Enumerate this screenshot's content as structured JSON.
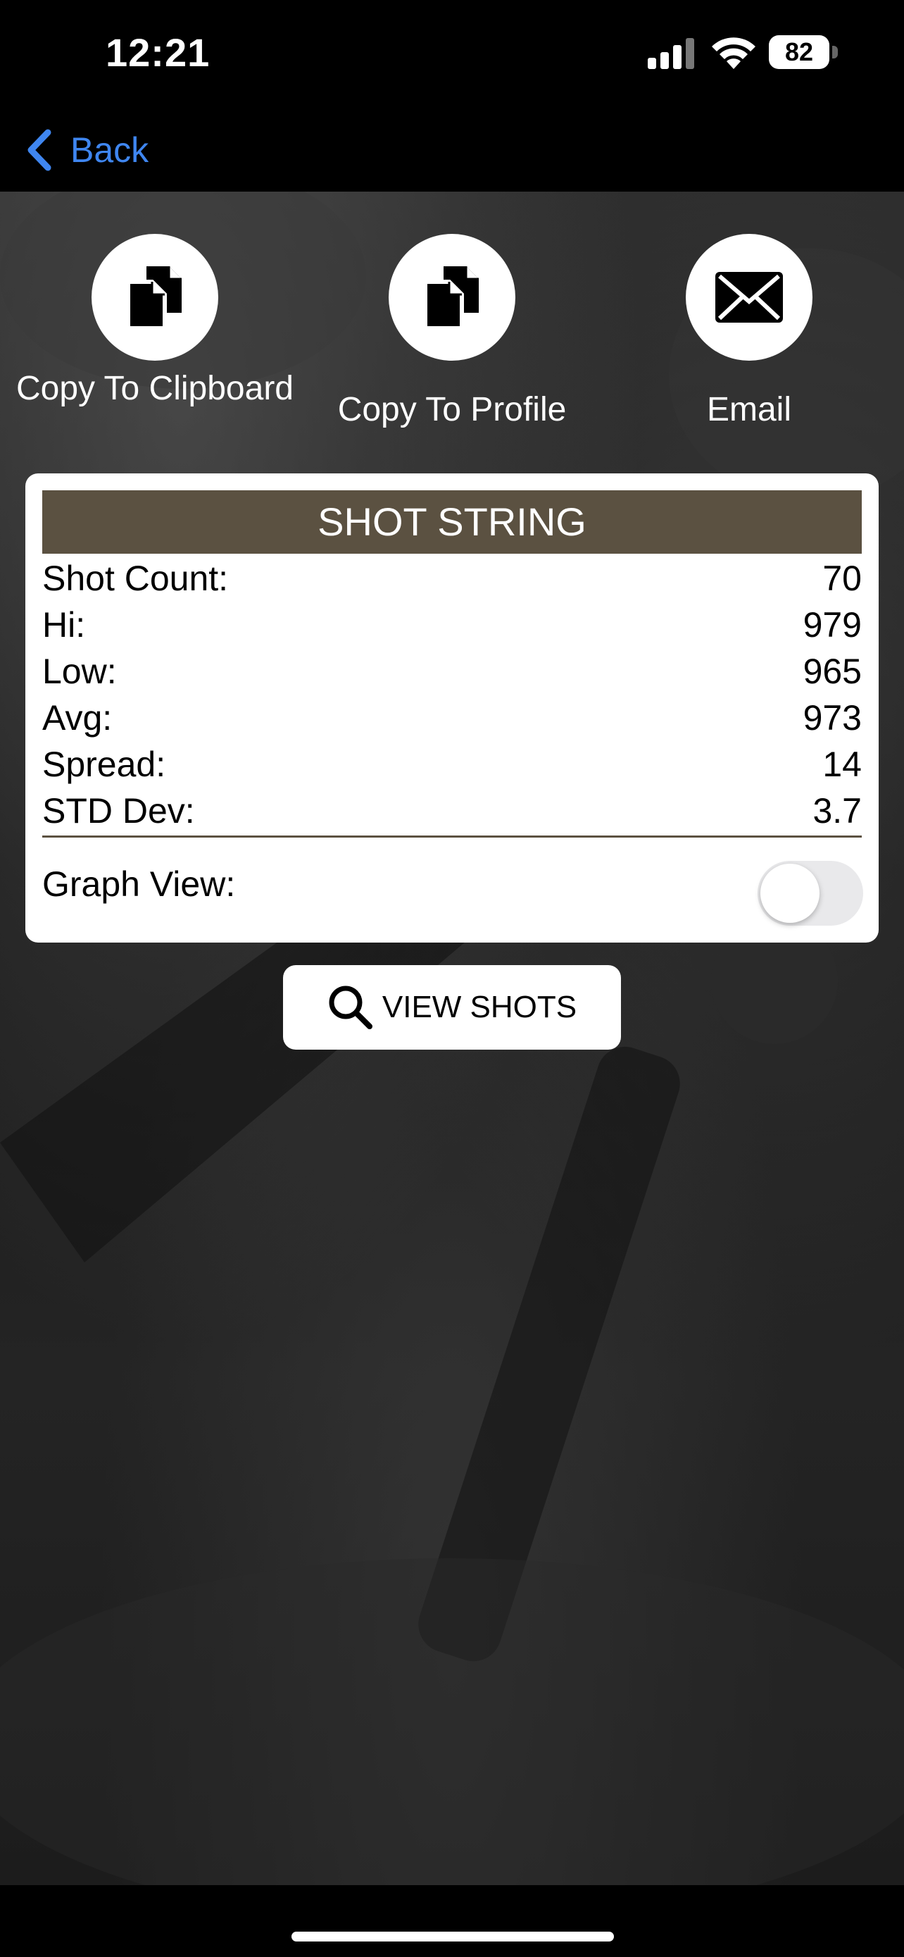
{
  "status_bar": {
    "time": "12:21",
    "battery_percent": "82",
    "icons": [
      "signal-icon",
      "wifi-icon",
      "battery-icon"
    ]
  },
  "nav": {
    "back_label": "Back",
    "back_icon": "chevron-left-icon",
    "accent_color": "#3f86f0"
  },
  "actions": [
    {
      "label": "Copy To Clipboard",
      "icon": "copy-icon"
    },
    {
      "label": "Copy To Profile",
      "icon": "copy-icon"
    },
    {
      "label": "Email",
      "icon": "envelope-icon"
    }
  ],
  "shot_string": {
    "title": "SHOT STRING",
    "header_color": "#5b5141",
    "rows": [
      {
        "label": "Shot Count:",
        "value": "70"
      },
      {
        "label": "Hi:",
        "value": "979"
      },
      {
        "label": "Low:",
        "value": "965"
      },
      {
        "label": "Avg:",
        "value": "973"
      },
      {
        "label": "Spread:",
        "value": "14"
      },
      {
        "label": "STD Dev:",
        "value": "3.7"
      }
    ],
    "graph_view_label": "Graph View:",
    "graph_view_on": false
  },
  "view_shots": {
    "label": "VIEW SHOTS",
    "icon": "magnifier-icon"
  }
}
